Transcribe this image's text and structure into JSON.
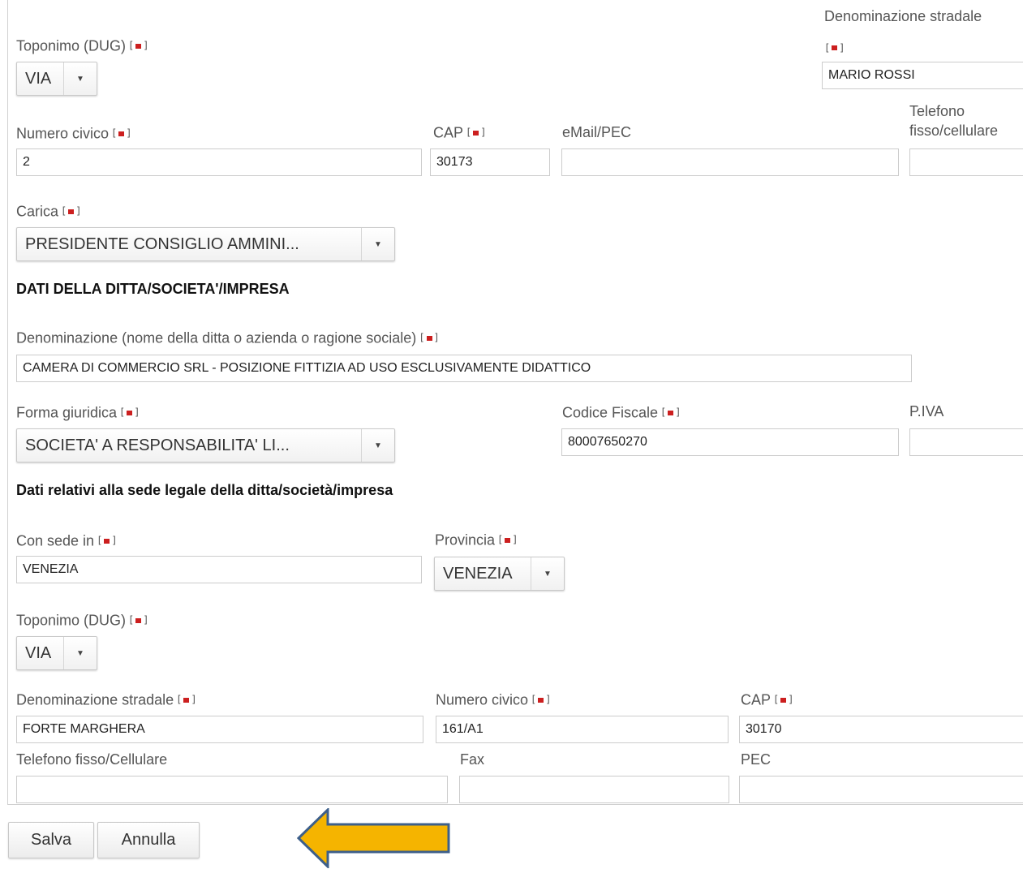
{
  "top": {
    "toponimo_label": "Toponimo (DUG)",
    "toponimo_value": "VIA",
    "denominazione_label": "Denominazione stradale",
    "denominazione_value": "MARIO ROSSI",
    "numero_civico_label": "Numero civico",
    "numero_civico_value": "2",
    "cap_label": "CAP",
    "cap_value": "30173",
    "email_label": "eMail/PEC",
    "email_value": "",
    "telefono_label_line1": "Telefono",
    "telefono_label_line2": "fisso/cellulare",
    "telefono_value": "",
    "carica_label": "Carica",
    "carica_value": "PRESIDENTE CONSIGLIO AMMINI..."
  },
  "ditta": {
    "section_title": "DATI DELLA DITTA/SOCIETA'/IMPRESA",
    "denominazione_label": "Denominazione (nome della ditta o azienda o ragione sociale)",
    "denominazione_value": "CAMERA DI COMMERCIO SRL - POSIZIONE FITTIZIA AD USO ESCLUSIVAMENTE DIDATTICO",
    "forma_label": "Forma giuridica",
    "forma_value": "SOCIETA' A RESPONSABILITA' LI...",
    "codice_fiscale_label": "Codice Fiscale",
    "codice_fiscale_value": "80007650270",
    "piva_label": "P.IVA",
    "piva_value": ""
  },
  "sede": {
    "section_title": "Dati relativi alla sede legale della ditta/società/impresa",
    "con_sede_label": "Con sede in",
    "con_sede_value": "VENEZIA",
    "provincia_label": "Provincia",
    "provincia_value": "VENEZIA",
    "toponimo_label": "Toponimo (DUG)",
    "toponimo_value": "VIA",
    "denominazione_label": "Denominazione stradale",
    "denominazione_value": "FORTE MARGHERA",
    "numero_civico_label": "Numero civico",
    "numero_civico_value": "161/A1",
    "cap_label": "CAP",
    "cap_value": "30170",
    "telefono_label": "Telefono fisso/Cellulare",
    "telefono_value": "",
    "fax_label": "Fax",
    "fax_value": "",
    "pec_label": "PEC",
    "pec_value": ""
  },
  "actions": {
    "save_label": "Salva",
    "cancel_label": "Annulla"
  },
  "icons": {
    "required_marker": "required-asterisk-icon",
    "dropdown": "chevron-down-icon",
    "pointer": "arrow-left-icon"
  },
  "colors": {
    "required_marker": "#cc1f1f",
    "arrow_fill": "#f5b400",
    "arrow_stroke": "#3d5f8a"
  }
}
